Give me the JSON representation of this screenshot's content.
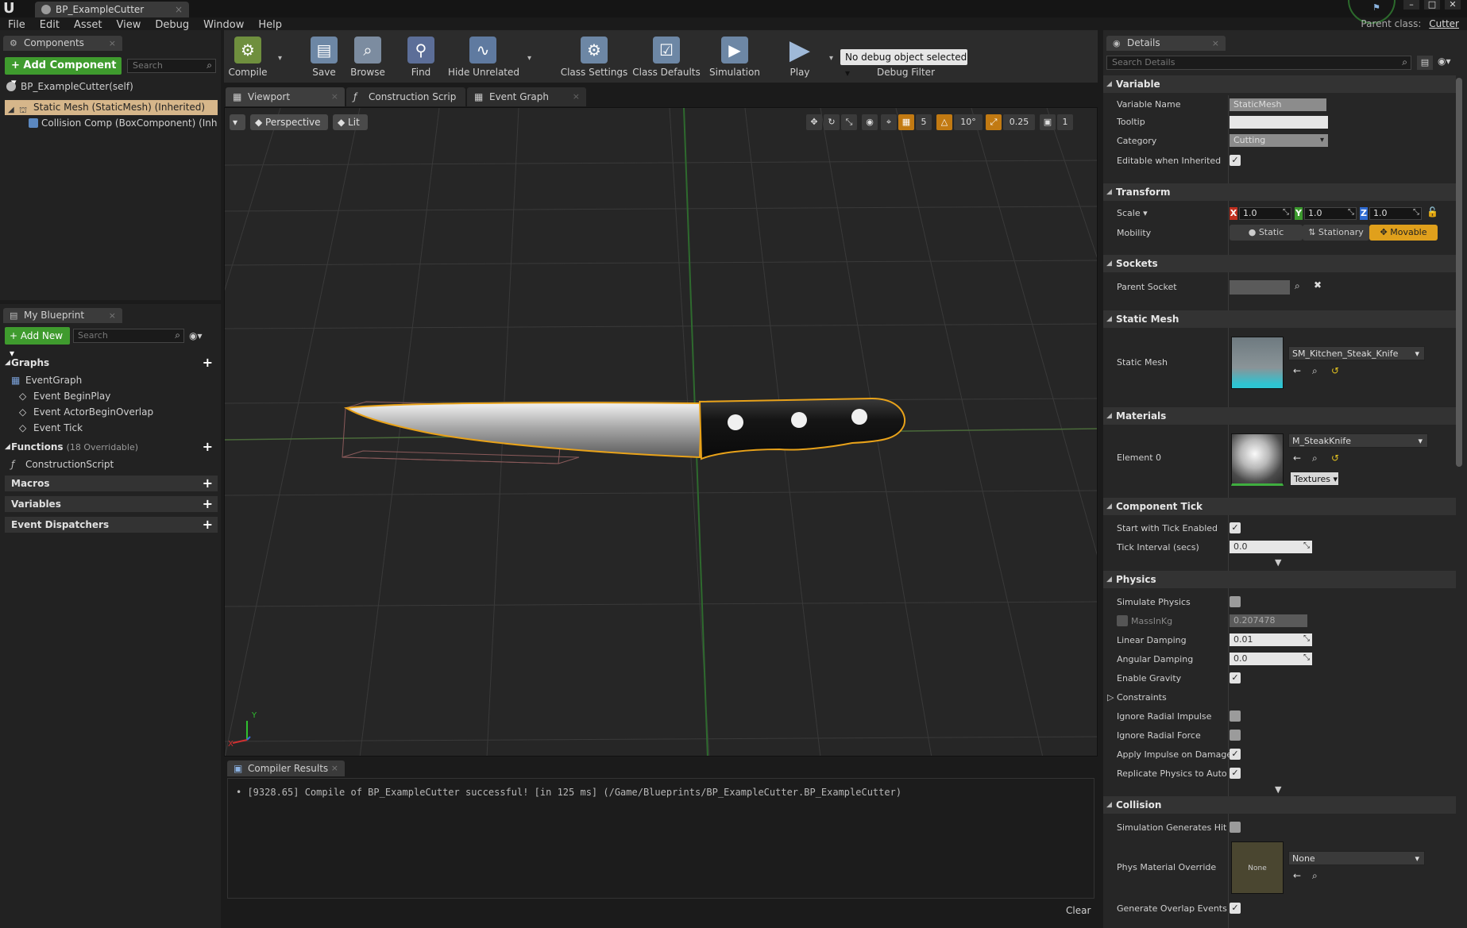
{
  "title_bar": {
    "document_tab": "BP_ExampleCutter",
    "parent_class_label": "Parent class:",
    "parent_class_value": "Cutter"
  },
  "menu": [
    "File",
    "Edit",
    "Asset",
    "View",
    "Debug",
    "Window",
    "Help"
  ],
  "components": {
    "tab": "Components",
    "add_button": "+ Add Component ▾",
    "search_placeholder": "Search",
    "self_item": "BP_ExampleCutter(self)",
    "static_mesh_item": "Static Mesh (StaticMesh) (Inherited)",
    "collision_item": "Collision Comp (BoxComponent) (Inherit"
  },
  "my_blueprint": {
    "tab": "My Blueprint",
    "add_button": "+ Add New ▾",
    "search_placeholder": "Search",
    "graphs_header": "Graphs",
    "event_graph": "EventGraph",
    "events": [
      "Event BeginPlay",
      "Event ActorBeginOverlap",
      "Event Tick"
    ],
    "functions_header": "Functions",
    "functions_sub": "(18 Overridable)",
    "construction_script": "ConstructionScript",
    "macros_header": "Macros",
    "variables_header": "Variables",
    "dispatchers_header": "Event Dispatchers"
  },
  "toolbar": {
    "compile": "Compile",
    "save": "Save",
    "browse": "Browse",
    "find": "Find",
    "hide_unrelated": "Hide Unrelated",
    "class_settings": "Class Settings",
    "class_defaults": "Class Defaults",
    "simulation": "Simulation",
    "play": "Play",
    "debug_select": "No debug object selected ▾",
    "debug_filter": "Debug Filter"
  },
  "editor_tabs": [
    "Viewport",
    "Construction Scrip",
    "Event Graph"
  ],
  "viewport": {
    "perspective": "Perspective",
    "lit": "Lit",
    "grid_snap": "5",
    "rot_snap": "10°",
    "scale_snap": "0.25",
    "camera_speed": "1",
    "axis_y": "Y",
    "axis_x": "X"
  },
  "compiler": {
    "tab": "Compiler Results",
    "message": "• [9328.65] Compile of BP_ExampleCutter successful! [in 125 ms] (/Game/Blueprints/BP_ExampleCutter.BP_ExampleCutter)",
    "clear": "Clear"
  },
  "details": {
    "tab": "Details",
    "search_placeholder": "Search Details",
    "variable": {
      "header": "Variable",
      "name_label": "Variable Name",
      "name_value": "StaticMesh",
      "tooltip_label": "Tooltip",
      "category_label": "Category",
      "category_value": "Cutting",
      "editable_label": "Editable when Inherited"
    },
    "transform": {
      "header": "Transform",
      "scale_label": "Scale ▾",
      "scale_x": "1.0",
      "scale_y": "1.0",
      "scale_z": "1.0",
      "mobility_label": "Mobility",
      "mobility_options": [
        "Static",
        "Stationary",
        "Movable"
      ],
      "mobility_selected": "Movable"
    },
    "sockets": {
      "header": "Sockets",
      "parent_socket_label": "Parent Socket"
    },
    "static_mesh": {
      "header": "Static Mesh",
      "label": "Static Mesh",
      "value": "SM_Kitchen_Steak_Knife"
    },
    "materials": {
      "header": "Materials",
      "element_label": "Element 0",
      "value": "M_SteakKnife",
      "textures_button": "Textures ▾"
    },
    "component_tick": {
      "header": "Component Tick",
      "start_label": "Start with Tick Enabled",
      "interval_label": "Tick Interval (secs)",
      "interval_value": "0.0"
    },
    "physics": {
      "header": "Physics",
      "simulate_label": "Simulate Physics",
      "mass_label": "MassInKg",
      "mass_value": "0.207478",
      "linear_label": "Linear Damping",
      "linear_value": "0.01",
      "angular_label": "Angular Damping",
      "angular_value": "0.0",
      "gravity_label": "Enable Gravity",
      "constraints_label": "Constraints",
      "radial_impulse_label": "Ignore Radial Impulse",
      "radial_force_label": "Ignore Radial Force",
      "impulse_damage_label": "Apply Impulse on Damage",
      "replicate_label": "Replicate Physics to Autono"
    },
    "collision": {
      "header": "Collision",
      "sim_hit_label": "Simulation Generates Hit Ev",
      "phys_material_label": "Phys Material Override",
      "phys_material_value": "None",
      "thumb_text": "None",
      "overlap_label": "Generate Overlap Events"
    }
  },
  "colors": {
    "accent_green": "#3f9b2e",
    "selection_tan": "#d6b68a",
    "movable_orange": "#e0a01c",
    "outline_orange": "#e8a21a"
  }
}
